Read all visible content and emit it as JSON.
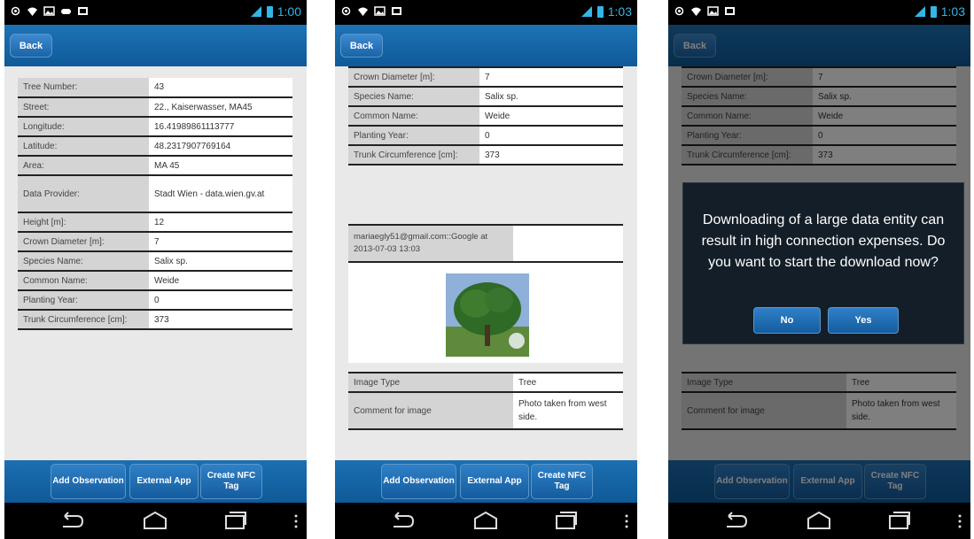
{
  "status_bar": {
    "screen1_time": "1:00",
    "screen2_time": "1:03",
    "screen3_time": "1:03"
  },
  "toolbar": {
    "back_label": "Back"
  },
  "screen1": {
    "rows": [
      {
        "label": "Tree Number:",
        "value": "43"
      },
      {
        "label": "Street:",
        "value": "22., Kaiserwasser, MA45"
      },
      {
        "label": "Longitude:",
        "value": "16.41989861113777"
      },
      {
        "label": "Latitude:",
        "value": "48.2317907769164"
      },
      {
        "label": "Area:",
        "value": "MA 45"
      },
      {
        "label": "Data Provider:",
        "value": "Stadt Wien - data.wien.gv.at"
      },
      {
        "label": "Height [m]:",
        "value": "12"
      },
      {
        "label": "Crown Diameter [m]:",
        "value": "7"
      },
      {
        "label": "Species Name:",
        "value": "Salix sp."
      },
      {
        "label": "Common Name:",
        "value": "Weide"
      },
      {
        "label": "Planting Year:",
        "value": "0"
      },
      {
        "label": "Trunk Circumference [cm]:",
        "value": "373"
      }
    ]
  },
  "screen2": {
    "rows": [
      {
        "label": "Crown Diameter [m]:",
        "value": "7"
      },
      {
        "label": "Species Name:",
        "value": "Salix sp."
      },
      {
        "label": "Common Name:",
        "value": "Weide"
      },
      {
        "label": "Planting Year:",
        "value": "0"
      },
      {
        "label": "Trunk Circumference [cm]:",
        "value": "373"
      }
    ],
    "comment_author": "mariaegly51@gmail.com::Google at 2013-07-03 13:03",
    "image_rows": [
      {
        "label": "Image Type",
        "value": "Tree"
      },
      {
        "label": "Comment for image",
        "value": "Photo taken from west side."
      }
    ]
  },
  "bottom_bar": {
    "add_observation": "Add Observation",
    "external_app": "External App",
    "create_nfc_tag": "Create NFC Tag"
  },
  "dialog": {
    "message": "Downloading of a large data entity can result in high connection expenses. Do you want to start the download now?",
    "no_label": "No",
    "yes_label": "Yes"
  }
}
